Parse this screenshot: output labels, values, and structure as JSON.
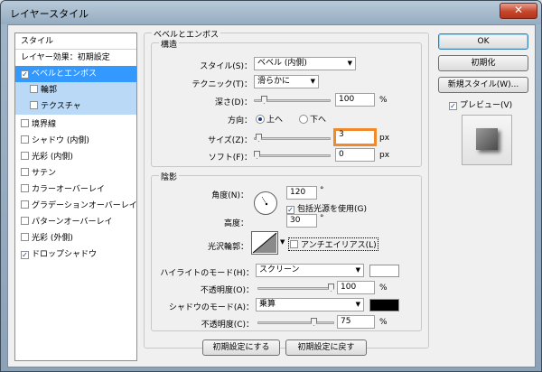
{
  "window": {
    "title": "レイヤースタイル",
    "close_icon": "✕"
  },
  "styles": {
    "header": "スタイル",
    "items": [
      {
        "label": "レイヤー効果：初期設定",
        "checkbox": false,
        "checked": false
      },
      {
        "label": "ベベルとエンボス",
        "checkbox": true,
        "checked": true,
        "selected": true
      },
      {
        "label": "輪郭",
        "checkbox": true,
        "checked": false,
        "sub": true
      },
      {
        "label": "テクスチャ",
        "checkbox": true,
        "checked": false,
        "sub": true
      },
      {
        "label": "境界線",
        "checkbox": true,
        "checked": false
      },
      {
        "label": "シャドウ (内側)",
        "checkbox": true,
        "checked": false
      },
      {
        "label": "光彩 (内側)",
        "checkbox": true,
        "checked": false
      },
      {
        "label": "サテン",
        "checkbox": true,
        "checked": false
      },
      {
        "label": "カラーオーバーレイ",
        "checkbox": true,
        "checked": false
      },
      {
        "label": "グラデーションオーバーレイ",
        "checkbox": true,
        "checked": false
      },
      {
        "label": "パターンオーバーレイ",
        "checkbox": true,
        "checked": false
      },
      {
        "label": "光彩 (外側)",
        "checkbox": true,
        "checked": false
      },
      {
        "label": "ドロップシャドウ",
        "checkbox": true,
        "checked": true
      }
    ]
  },
  "bevel": {
    "title": "ベベルとエンボス",
    "structure": {
      "title": "構造",
      "style_label": "スタイル(S)：",
      "style_value": "ベベル (内側)",
      "technique_label": "テクニック(T)：",
      "technique_value": "滑らかに",
      "depth_label": "深さ(D)：",
      "depth_value": "100",
      "depth_unit": "%",
      "depth_level": 0.1,
      "direction_label": "方向：",
      "direction_up": "上へ",
      "direction_down": "下へ",
      "size_label": "サイズ(Z)：",
      "size_value": "3",
      "size_unit": "px",
      "size_level": 0.02,
      "soften_label": "ソフト(F)：",
      "soften_value": "0",
      "soften_unit": "px",
      "soften_level": 0.0
    },
    "shading": {
      "title": "陰影",
      "angle_label": "角度(N)：",
      "angle_value": "120",
      "angle_unit": "°",
      "global_light_label": "包括光源を使用(G)",
      "global_light_checked": true,
      "altitude_label": "高度：",
      "altitude_value": "30",
      "altitude_unit": "°",
      "gloss_label": "光沢輪郭：",
      "antialias_label": "アンチエイリアス(L)",
      "antialias_checked": false,
      "highlight_mode_label": "ハイライトのモード(H)：",
      "highlight_mode_value": "スクリーン",
      "highlight_color": "#ffffff",
      "highlight_opacity_label": "不透明度(O)：",
      "highlight_opacity_value": "100",
      "highlight_opacity_unit": "%",
      "highlight_opacity_level": 1.0,
      "shadow_mode_label": "シャドウのモード(A)：",
      "shadow_mode_value": "乗算",
      "shadow_color": "#000000",
      "shadow_opacity_label": "不透明度(C)：",
      "shadow_opacity_value": "75",
      "shadow_opacity_unit": "%",
      "shadow_opacity_level": 0.75
    },
    "make_default_label": "初期設定にする",
    "reset_default_label": "初期設定に戻す"
  },
  "actions": {
    "ok_label": "OK",
    "reset_label": "初期化",
    "new_style_label": "新規スタイル(W)...",
    "preview_label": "プレビュー(V)",
    "preview_checked": true
  },
  "colors": {
    "accent": "#3399ff",
    "focus_outline": "#f08a2a"
  }
}
